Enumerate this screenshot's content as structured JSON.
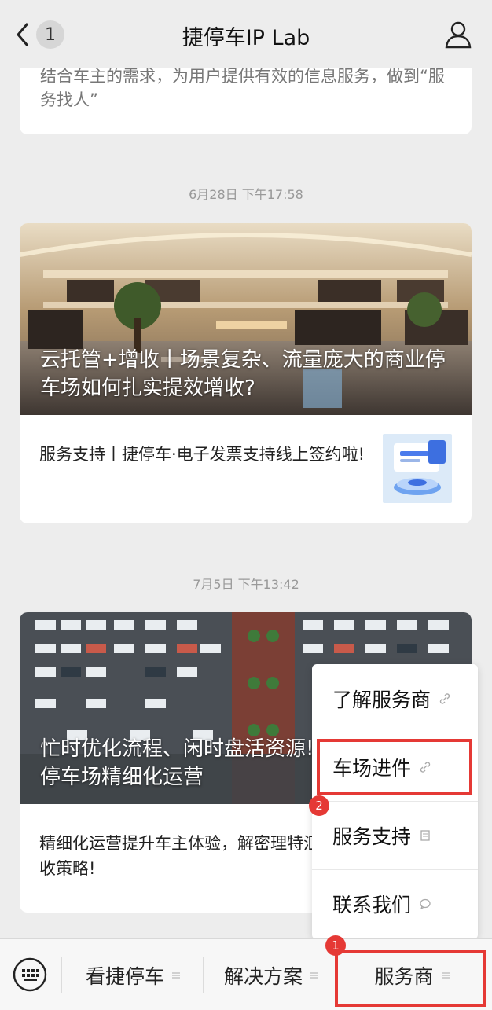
{
  "header": {
    "back_count": "1",
    "title": "捷停车IP Lab"
  },
  "feed": {
    "partial_card_text": "结合车主的需求，为用户提供有效的信息服务，做到“服务找人”",
    "groups": [
      {
        "time": "6月28日 下午17:58",
        "hero_title": "云托管+增收丨场景复杂、流量庞大的商业停车场如何扎实提效增收?",
        "sub_title": "服务支持丨捷停车·电子发票支持线上签约啦!"
      },
      {
        "time": "7月5日 下午13:42",
        "hero_title": "忙时优化流程、闲时盘活资源!购物中心实现停车场精细化运营",
        "sub_title": "精细化运营提升车主体验，解密理特汇车场增收策略!"
      }
    ]
  },
  "popup_menu": {
    "items": [
      "了解服务商",
      "车场进件",
      "服务支持",
      "联系我们"
    ]
  },
  "bottom_bar": {
    "tabs": [
      "看捷停车",
      "解决方案",
      "服务商"
    ]
  },
  "annotations": {
    "badge_1": "1",
    "badge_2": "2",
    "highlight_color": "#e53935"
  }
}
